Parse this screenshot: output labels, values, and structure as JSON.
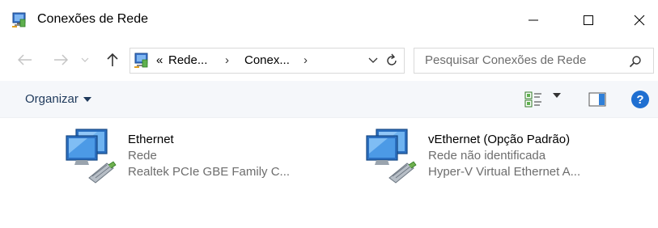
{
  "window": {
    "title": "Conexões de Rede"
  },
  "address": {
    "overflow": "«",
    "crumbs": [
      "Rede...",
      "Conex..."
    ],
    "sep": "›"
  },
  "search": {
    "placeholder": "Pesquisar Conexões de Rede"
  },
  "toolbar": {
    "organize_label": "Organizar",
    "help_label": "?"
  },
  "connections": [
    {
      "name": "Ethernet",
      "network": "Rede",
      "adapter": "Realtek PCIe GBE Family C..."
    },
    {
      "name": "vEthernet (Opção Padrão)",
      "network": "Rede não identificada",
      "adapter": "Hyper-V Virtual Ethernet A..."
    }
  ],
  "colors": {
    "accent": "#1f6fd1",
    "command_bar": "#f5f7fa",
    "secondary_text": "#6d6d6d"
  },
  "icons": {
    "title": "network-connections-icon",
    "item": "network-adapter-icon"
  }
}
